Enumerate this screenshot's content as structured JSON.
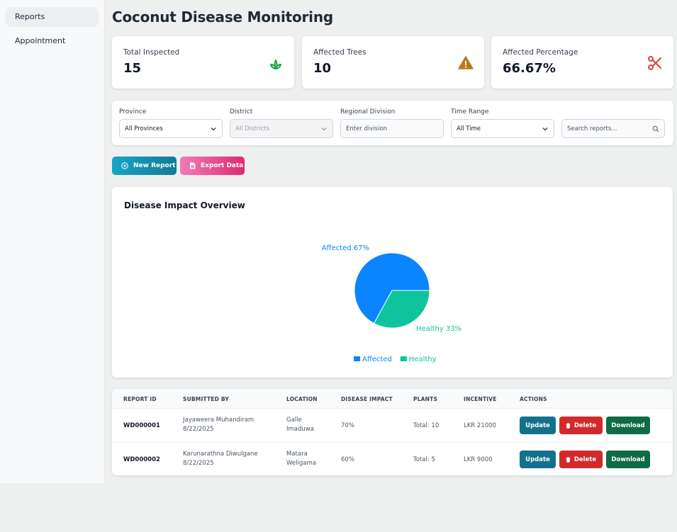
{
  "sidebar": {
    "items": [
      {
        "label": "Reports"
      },
      {
        "label": "Appointment"
      }
    ]
  },
  "page": {
    "title": "Coconut Disease Monitoring"
  },
  "stats": [
    {
      "label": "Total Inspected",
      "value": "15",
      "icon": "sprout-icon",
      "color": "#16a34a"
    },
    {
      "label": "Affected Trees",
      "value": "10",
      "icon": "warning-icon",
      "color": "#b7791f"
    },
    {
      "label": "Affected Percentage",
      "value": "66.67%",
      "icon": "scissors-icon",
      "color": "#e53e3e"
    }
  ],
  "filters": {
    "province": {
      "label": "Province",
      "value": "All Provinces"
    },
    "district": {
      "label": "District",
      "value": "All Districts"
    },
    "division": {
      "label": "Regional Division",
      "placeholder": "Enter division"
    },
    "time_range": {
      "label": "Time Range",
      "value": "All Time"
    },
    "search": {
      "placeholder": "Search reports..."
    }
  },
  "actions": {
    "new_report": "New Report",
    "export_data": "Export Data"
  },
  "chart": {
    "title": "Disease Impact Overview"
  },
  "chart_data": {
    "type": "pie",
    "title": "Disease Impact Overview",
    "slices": [
      {
        "name": "Affected",
        "value": 67,
        "label": "Affected 67%",
        "color": "#0a84ff"
      },
      {
        "name": "Healthy",
        "value": 33,
        "label": "Healthy 33%",
        "color": "#0ec49b"
      }
    ],
    "legend": "bottom"
  },
  "table": {
    "headers": [
      "REPORT ID",
      "SUBMITTED BY",
      "LOCATION",
      "DISEASE IMPACT",
      "PLANTS",
      "INCENTIVE",
      "ACTIONS"
    ],
    "rows": [
      {
        "id": "WD000001",
        "name": "Jayaweera Muhandiram",
        "date": "8/22/2025",
        "loc1": "Galle",
        "loc2": "Imaduwa",
        "impact": "70%",
        "plants": "Total: 10",
        "incentive": "LKR 21000"
      },
      {
        "id": "WD000002",
        "name": "Karunarathna Diwulgane",
        "date": "8/22/2025",
        "loc1": "Matara",
        "loc2": "Weligama",
        "impact": "60%",
        "plants": "Total: 5",
        "incentive": "LKR 9000"
      }
    ],
    "buttons": {
      "update": "Update",
      "delete": "Delete",
      "download": "Download"
    }
  }
}
